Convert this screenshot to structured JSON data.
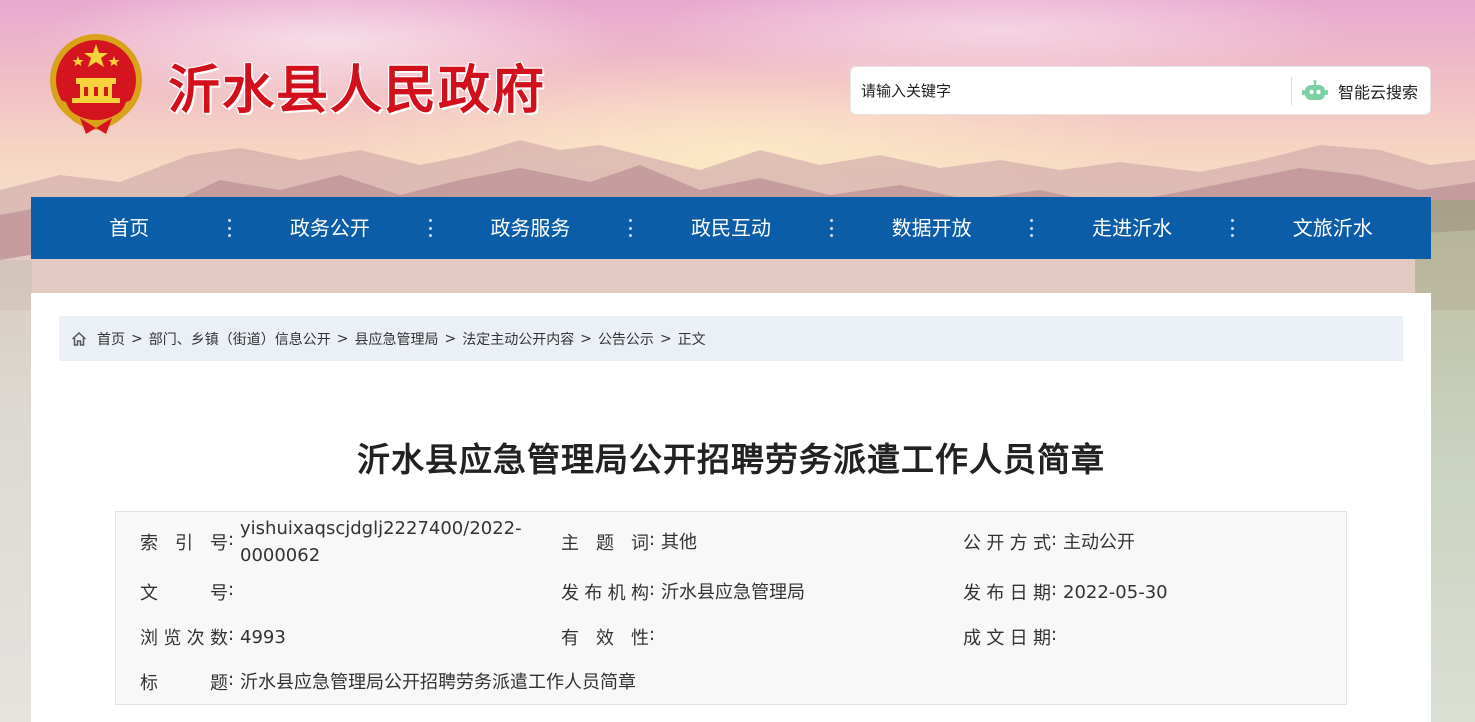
{
  "header": {
    "site_title": "沂水县人民政府",
    "search_placeholder": "请输入关键字",
    "search_button": "智能云搜索",
    "search_icon": "robot-icon",
    "emblem": "national-emblem"
  },
  "nav": {
    "items": [
      {
        "label": "首页"
      },
      {
        "label": "政务公开"
      },
      {
        "label": "政务服务"
      },
      {
        "label": "政民互动"
      },
      {
        "label": "数据开放"
      },
      {
        "label": "走进沂水"
      },
      {
        "label": "文旅沂水"
      }
    ]
  },
  "breadcrumb": {
    "home_icon": "home-icon",
    "items": [
      {
        "label": "首页"
      },
      {
        "label": "部门、乡镇（街道）信息公开"
      },
      {
        "label": "县应急管理局"
      },
      {
        "label": "法定主动公开内容"
      },
      {
        "label": "公告公示"
      }
    ],
    "separator": ">",
    "current": "正文"
  },
  "article": {
    "title": "沂水县应急管理局公开招聘劳务派遣工作人员简章"
  },
  "meta": {
    "index_no_label": "索引号",
    "index_no_value_line1": "yishuixaqscjdglj2227400/2022-",
    "index_no_value_line2": "0000062",
    "subject_label": "主题词",
    "subject_value": "其他",
    "open_mode_label": "公开方式",
    "open_mode_value": "主动公开",
    "doc_no_label": "文号",
    "doc_no_value": "",
    "publisher_label": "发布机构",
    "publisher_value": "沂水县应急管理局",
    "publish_date_label": "发布日期",
    "publish_date_value": "2022-05-30",
    "views_label": "浏览次数",
    "views_value": "4993",
    "validity_label": "有效性",
    "validity_value": "",
    "written_date_label": "成文日期",
    "written_date_value": "",
    "title_label": "标题",
    "title_value": "沂水县应急管理局公开招聘劳务派遣工作人员简章",
    "colon": ":"
  },
  "colors": {
    "nav_bg": "#0c5da8",
    "title_red": "#d2101b",
    "breadcrumb_bg": "#ebf0f7"
  }
}
